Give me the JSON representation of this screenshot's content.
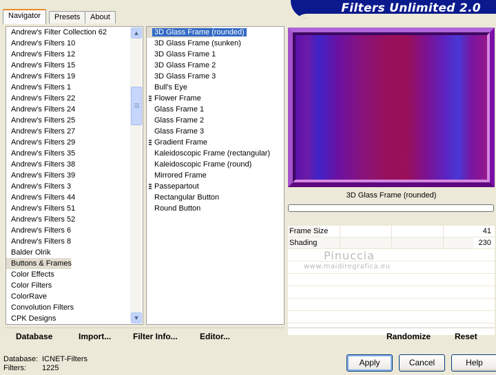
{
  "tabs": [
    "Navigator",
    "Presets",
    "About"
  ],
  "app_title": "Filters Unlimited 2.0",
  "categories": [
    "Andrew's Filter Collection 62",
    "Andrew's Filters 10",
    "Andrew's Filters 12",
    "Andrew's Filters 15",
    "Andrew's Filters 19",
    "Andrew's Filters 1",
    "Andrew's Filters 22",
    "Andrew's Filters 24",
    "Andrew's Filters 25",
    "Andrew's Filters 27",
    "Andrew's Filters 29",
    "Andrew's Filters 35",
    "Andrew's Filters 38",
    "Andrew's Filters 39",
    "Andrew's Filters 3",
    "Andrew's Filters 44",
    "Andrew's Filters 51",
    "Andrew's Filters 52",
    "Andrew's Filters 6",
    "Andrew's Filters 8",
    "Balder Olrik",
    "Buttons & Frames",
    "Color Effects",
    "Color Filters",
    "ColorRave",
    "Convolution Filters",
    "CPK Designs"
  ],
  "selected_category": "Buttons & Frames",
  "filters": [
    {
      "label": "3D Glass Frame (rounded)",
      "marker": false
    },
    {
      "label": "3D Glass Frame (sunken)",
      "marker": false
    },
    {
      "label": "3D Glass Frame 1",
      "marker": false
    },
    {
      "label": "3D Glass Frame 2",
      "marker": false
    },
    {
      "label": "3D Glass Frame 3",
      "marker": false
    },
    {
      "label": "Bull's Eye",
      "marker": false
    },
    {
      "label": "Flower Frame",
      "marker": true
    },
    {
      "label": "Glass Frame 1",
      "marker": false
    },
    {
      "label": "Glass Frame 2",
      "marker": false
    },
    {
      "label": "Glass Frame 3",
      "marker": false
    },
    {
      "label": "Gradient Frame",
      "marker": true
    },
    {
      "label": "Kaleidoscopic Frame (rectangular)",
      "marker": false
    },
    {
      "label": "Kaleidoscopic Frame (round)",
      "marker": false
    },
    {
      "label": "Mirrored Frame",
      "marker": false
    },
    {
      "label": "Passepartout",
      "marker": true
    },
    {
      "label": "Rectangular Button",
      "marker": false
    },
    {
      "label": "Round Button",
      "marker": false
    }
  ],
  "selected_filter": "3D Glass Frame (rounded)",
  "preview_label": "3D Glass Frame (rounded)",
  "params": [
    {
      "name": "Frame Size",
      "value": "41",
      "level": 0.16
    },
    {
      "name": "Shading",
      "value": "230",
      "level": 0.9
    }
  ],
  "watermark": {
    "line1": "Pinuccia",
    "line2": "www.maidiregrafica.eu"
  },
  "toolbar_left": [
    "Database",
    "Import...",
    "Filter Info...",
    "Editor..."
  ],
  "toolbar_right": [
    "Randomize",
    "Reset"
  ],
  "status": {
    "database_label": "Database:",
    "database_value": "ICNET-Filters",
    "filters_label": "Filters:",
    "filters_value": "1225"
  },
  "buttons": {
    "apply": "Apply",
    "cancel": "Cancel",
    "help": "Help"
  },
  "colors": {
    "banner": "#0a1a8c",
    "selection": "#316ac5",
    "tab_highlight": "#e68b2c"
  }
}
